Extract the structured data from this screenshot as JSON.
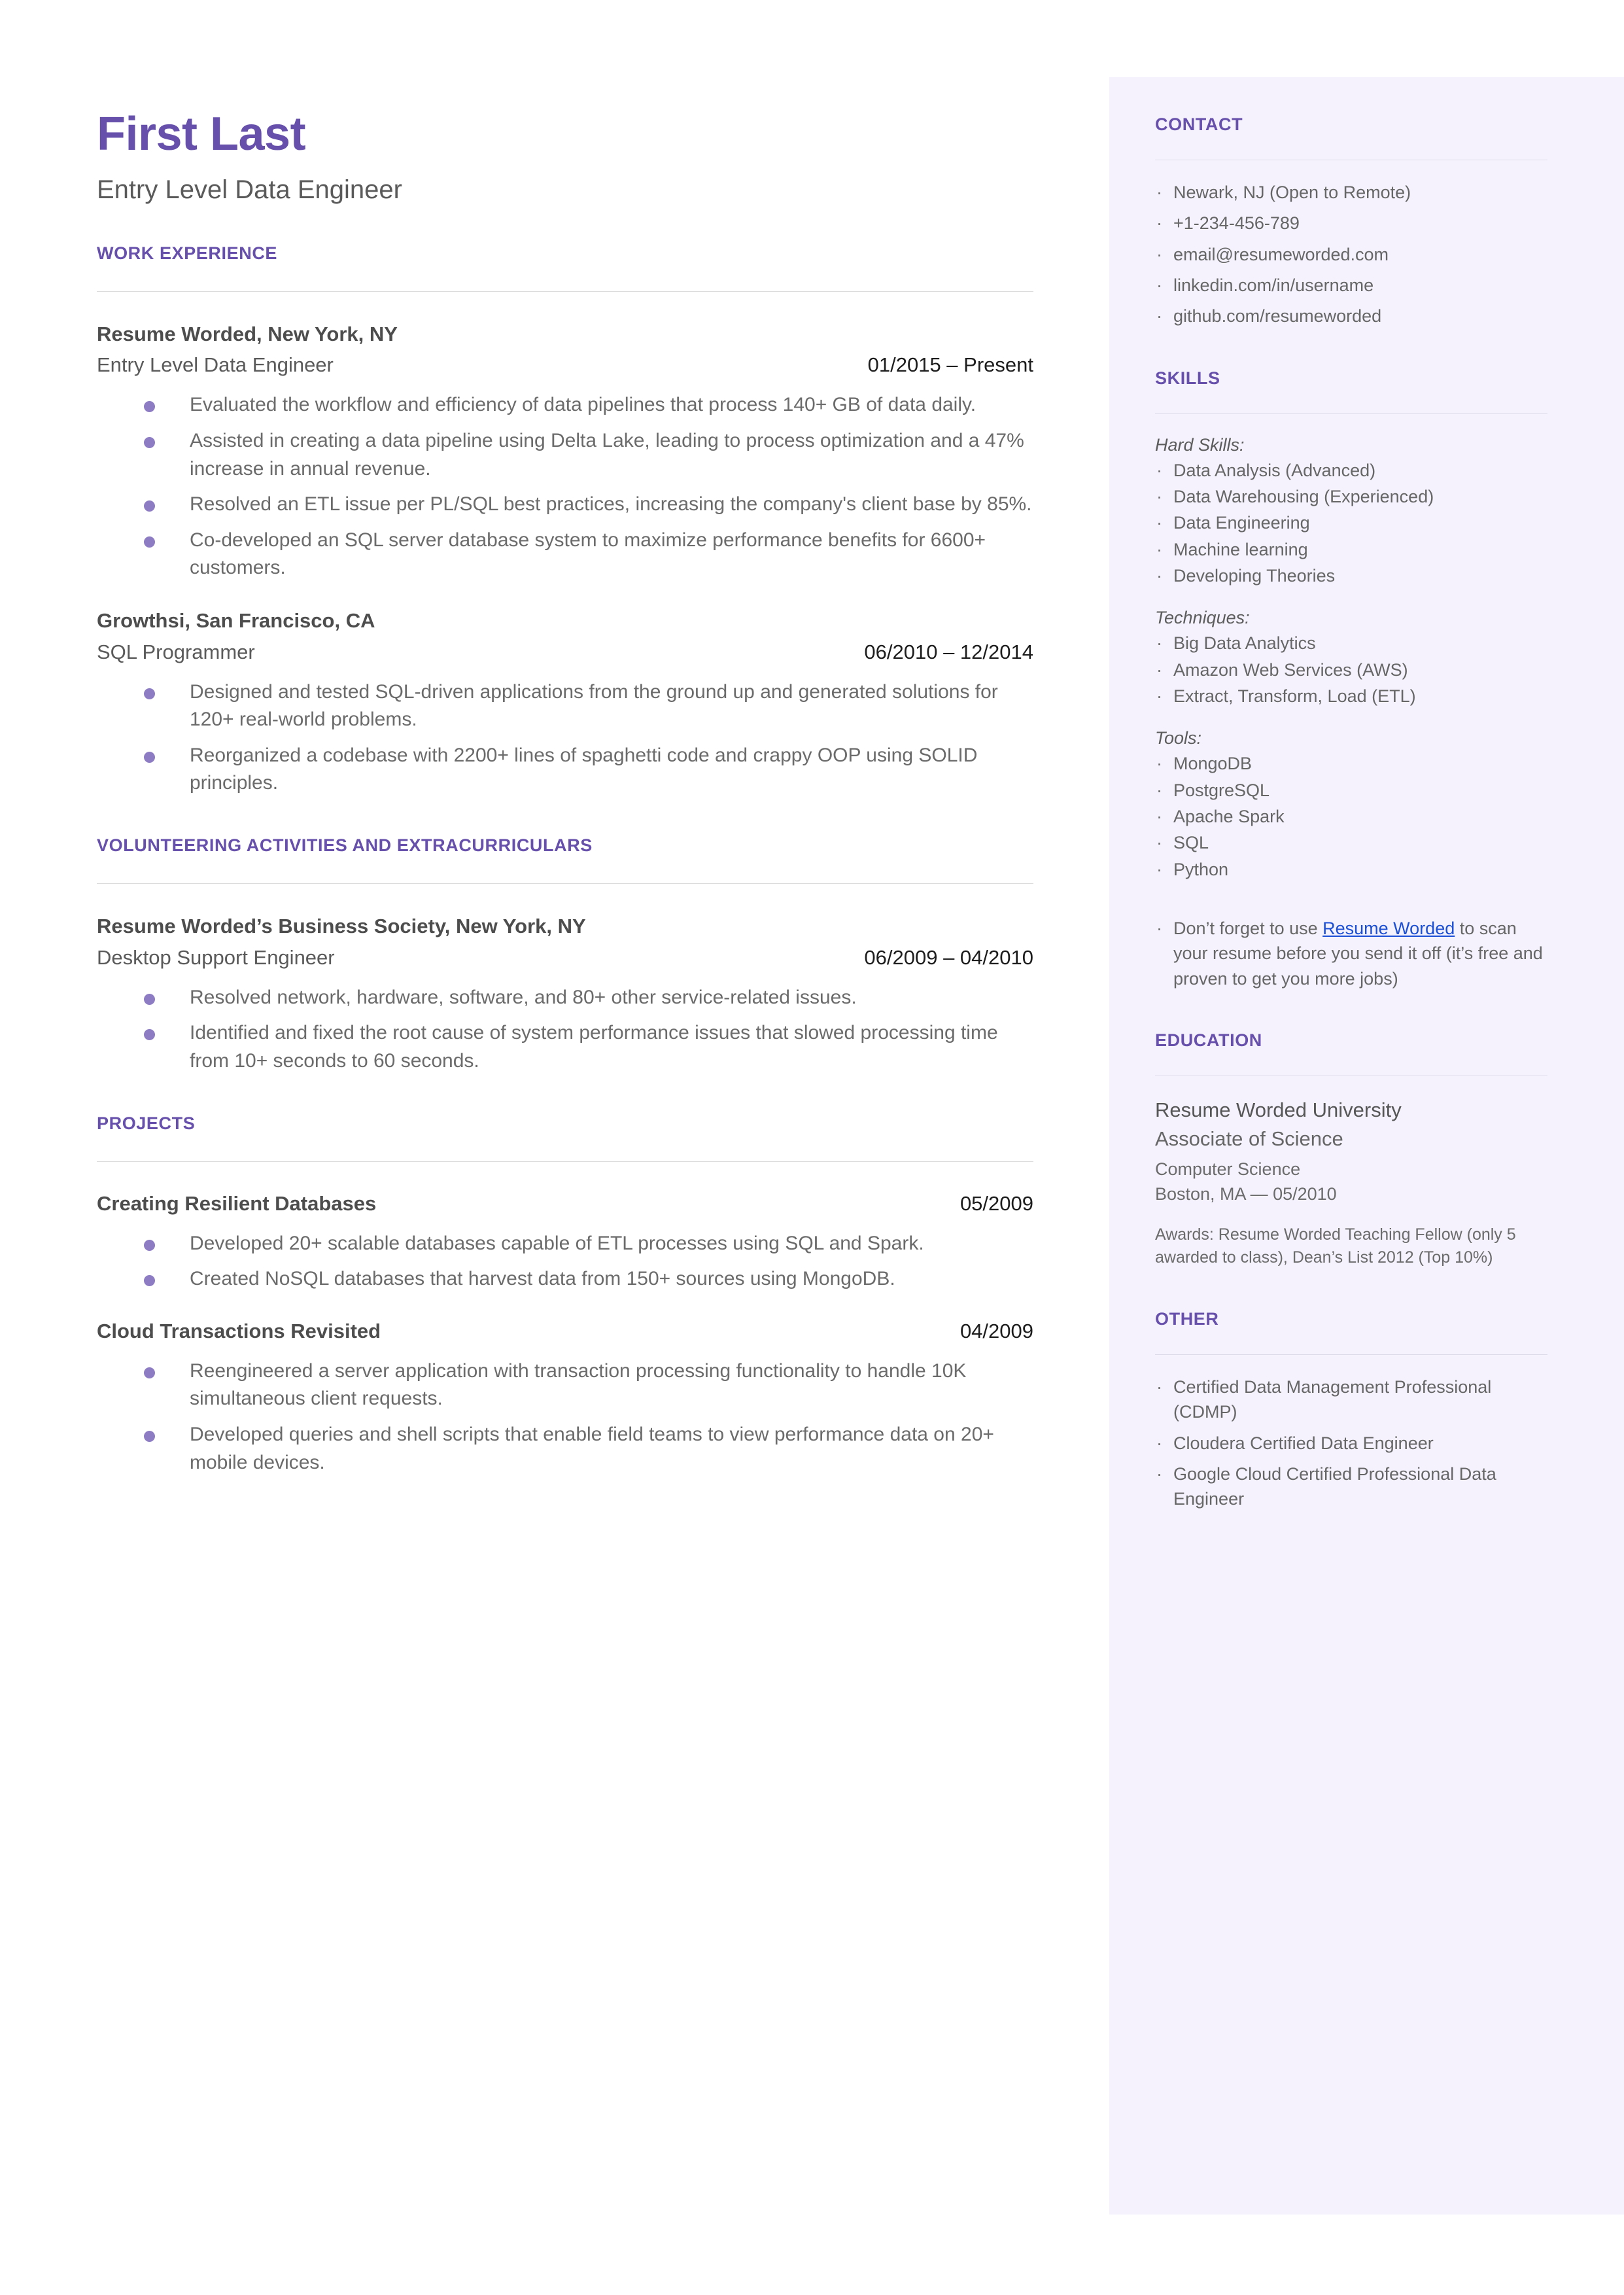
{
  "theme": {
    "accent": "#6650ac",
    "sidebar_bg": "#f5f2fd",
    "bullet": "#8d7cc4",
    "link": "#1a4fd6",
    "body_text": "#666666",
    "heading_text": "#4d4d4d"
  },
  "header": {
    "name": "First Last",
    "headline": "Entry Level Data Engineer"
  },
  "sections": {
    "work_experience": {
      "title": "WORK EXPERIENCE",
      "entries": [
        {
          "org": "Resume Worded, New York, NY",
          "role": "Entry Level Data Engineer",
          "date": "01/2015 – Present",
          "bullets": [
            "Evaluated the workflow and efficiency of data pipelines that process 140+ GB of data daily.",
            "Assisted in creating a data pipeline using Delta Lake, leading to process optimization and a 47% increase in annual revenue.",
            "Resolved an ETL issue per PL/SQL best practices, increasing the company's client base by 85%.",
            "Co-developed an SQL server database system to maximize performance benefits for 6600+ customers."
          ]
        },
        {
          "org": "Growthsi, San Francisco, CA",
          "role": "SQL Programmer",
          "date": "06/2010 – 12/2014",
          "bullets": [
            "Designed and tested SQL-driven applications from the ground up and generated solutions for 120+ real-world problems.",
            "Reorganized a codebase with 2200+ lines of spaghetti code and crappy OOP using SOLID principles."
          ]
        }
      ]
    },
    "volunteering": {
      "title": "VOLUNTEERING ACTIVITIES AND EXTRACURRICULARS",
      "entries": [
        {
          "org": "Resume Worded’s Business Society, New York, NY",
          "role": "Desktop Support Engineer",
          "date": "06/2009 – 04/2010",
          "bullets": [
            "Resolved network, hardware, software, and 80+ other service-related issues.",
            "Identified and fixed the root cause of system performance issues that slowed processing time from 10+ seconds to 60 seconds."
          ]
        }
      ]
    },
    "projects": {
      "title": "PROJECTS",
      "entries": [
        {
          "title": "Creating Resilient Databases",
          "date": "05/2009",
          "bullets": [
            "Developed 20+ scalable databases capable of ETL processes using SQL and Spark.",
            "Created NoSQL databases that harvest data from 150+ sources using MongoDB."
          ]
        },
        {
          "title": "Cloud Transactions Revisited",
          "date": "04/2009",
          "bullets": [
            "Reengineered a server application with transaction processing functionality to handle 10K simultaneous client requests.",
            "Developed queries and shell scripts that enable field teams to view performance data on 20+ mobile devices."
          ]
        }
      ]
    }
  },
  "sidebar": {
    "contact": {
      "title": "CONTACT",
      "items": [
        "Newark, NJ (Open to Remote)",
        "+1-234-456-789",
        "email@resumeworded.com",
        "linkedin.com/in/username",
        "github.com/resumeworded"
      ]
    },
    "skills": {
      "title": "SKILLS",
      "groups": [
        {
          "label": "Hard Skills:",
          "items": [
            "Data Analysis (Advanced)",
            "Data Warehousing (Experienced)",
            "Data Engineering",
            "Machine learning",
            "Developing Theories"
          ]
        },
        {
          "label": "Techniques:",
          "items": [
            "Big Data Analytics",
            "Amazon Web Services (AWS)",
            "Extract, Transform, Load (ETL)"
          ]
        },
        {
          "label": "Tools:",
          "items": [
            "MongoDB",
            "PostgreSQL",
            "Apache Spark",
            "SQL",
            "Python"
          ]
        }
      ],
      "promo": {
        "before": "Don’t forget to use ",
        "link": "Resume Worded",
        "after": " to scan your resume before you send it off (it’s free and proven to get you more jobs)"
      }
    },
    "education": {
      "title": "EDUCATION",
      "school": "Resume Worded University",
      "degree": "Associate of Science",
      "field": "Computer Science",
      "location_date": "Boston, MA — 05/2010",
      "awards": "Awards: Resume Worded Teaching Fellow (only 5 awarded to class), Dean’s List 2012 (Top 10%)"
    },
    "other": {
      "title": "OTHER",
      "items": [
        "Certified Data Management Professional (CDMP)",
        "Cloudera Certified Data Engineer",
        "Google Cloud Certified Professional Data Engineer"
      ]
    }
  }
}
